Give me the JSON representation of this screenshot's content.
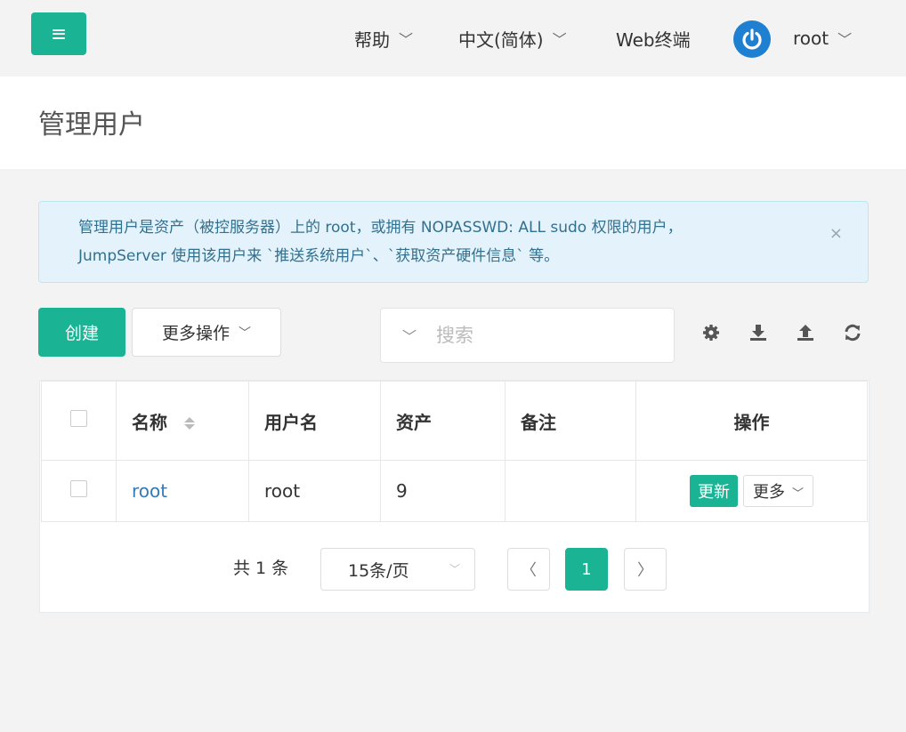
{
  "topbar": {
    "help": "帮助",
    "language": "中文(简体)",
    "web_terminal": "Web终端",
    "user": "root"
  },
  "page_title": "管理用户",
  "alert": {
    "line1": "管理用户是资产（被控服务器）上的 root，或拥有 NOPASSWD: ALL sudo 权限的用户，",
    "line2": "JumpServer 使用该用户来 `推送系统用户`、`获取资产硬件信息` 等。",
    "close": "×"
  },
  "toolbar": {
    "create_label": "创建",
    "more_label": "更多操作",
    "search_placeholder": "搜索"
  },
  "table": {
    "headers": {
      "name": "名称",
      "username": "用户名",
      "assets": "资产",
      "comment": "备注",
      "actions": "操作"
    },
    "rows": [
      {
        "name": "root",
        "username": "root",
        "assets": "9",
        "comment": "",
        "update": "更新",
        "more": "更多"
      }
    ]
  },
  "pagination": {
    "total": "共 1 条",
    "page_size": "15条/页",
    "current_page": "1"
  },
  "colors": {
    "primary": "#1ab394",
    "alert_bg": "#e4f3fb",
    "alert_text": "#31708f",
    "link": "#337ab7"
  }
}
